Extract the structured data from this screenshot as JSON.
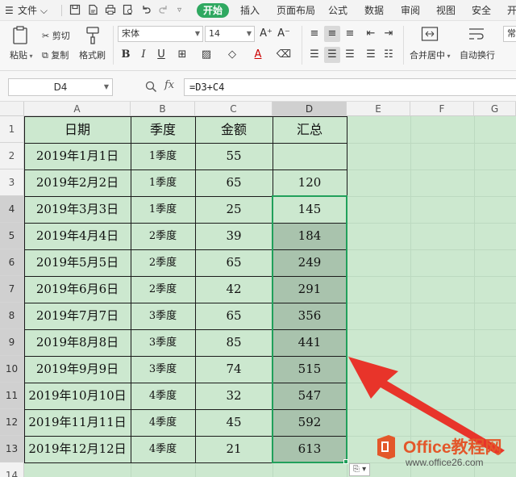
{
  "menubar": {
    "file_label": "文件",
    "tabs": [
      {
        "label": "开始",
        "active": true
      },
      {
        "label": "插入",
        "active": false
      },
      {
        "label": "页面布局",
        "active": false
      },
      {
        "label": "公式",
        "active": false
      },
      {
        "label": "数据",
        "active": false
      },
      {
        "label": "审阅",
        "active": false
      },
      {
        "label": "视图",
        "active": false
      },
      {
        "label": "安全",
        "active": false
      },
      {
        "label": "开",
        "active": false
      }
    ]
  },
  "ribbon": {
    "cut_label": "剪切",
    "copy_label": "复制",
    "paste_label": "粘贴",
    "format_painter_label": "格式刷",
    "font_name": "宋体",
    "font_size": "14",
    "merge_center_label": "合并居中",
    "wrap_text_label": "自动换行",
    "overflow_char": "常"
  },
  "formula_bar": {
    "name_box": "D4",
    "fx_label": "fx",
    "formula": "=D3+C4"
  },
  "sheet": {
    "columns": [
      "A",
      "B",
      "C",
      "D",
      "E",
      "F",
      "G"
    ],
    "active_column": "D",
    "row_numbers": [
      "1",
      "2",
      "3",
      "4",
      "5",
      "6",
      "7",
      "8",
      "9",
      "10",
      "11",
      "12",
      "13",
      "14"
    ],
    "headers": [
      "日期",
      "季度",
      "金额",
      "汇总"
    ],
    "rows": [
      {
        "date": "2019年1月1日",
        "quarter": "1季度",
        "amount": "55",
        "total": ""
      },
      {
        "date": "2019年2月2日",
        "quarter": "1季度",
        "amount": "65",
        "total": "120"
      },
      {
        "date": "2019年3月3日",
        "quarter": "1季度",
        "amount": "25",
        "total": "145"
      },
      {
        "date": "2019年4月4日",
        "quarter": "2季度",
        "amount": "39",
        "total": "184"
      },
      {
        "date": "2019年5月5日",
        "quarter": "2季度",
        "amount": "65",
        "total": "249"
      },
      {
        "date": "2019年6月6日",
        "quarter": "2季度",
        "amount": "42",
        "total": "291"
      },
      {
        "date": "2019年7月7日",
        "quarter": "3季度",
        "amount": "65",
        "total": "356"
      },
      {
        "date": "2019年8月8日",
        "quarter": "3季度",
        "amount": "85",
        "total": "441"
      },
      {
        "date": "2019年9月9日",
        "quarter": "3季度",
        "amount": "74",
        "total": "515"
      },
      {
        "date": "2019年10月10日",
        "quarter": "4季度",
        "amount": "32",
        "total": "547"
      },
      {
        "date": "2019年11月11日",
        "quarter": "4季度",
        "amount": "45",
        "total": "592"
      },
      {
        "date": "2019年12月12日",
        "quarter": "4季度",
        "amount": "21",
        "total": "613"
      }
    ]
  },
  "annotation": {
    "arrow_color": "#e8342a"
  },
  "watermark": {
    "title": "Office教程网",
    "url": "www.office26.com"
  },
  "colors": {
    "sheet_bg": "#cce8cf",
    "selection_border": "#21a05b",
    "selected_fill": "#a9c3ad",
    "active_tab": "#2fa860",
    "watermark_title": "#e3572a"
  }
}
